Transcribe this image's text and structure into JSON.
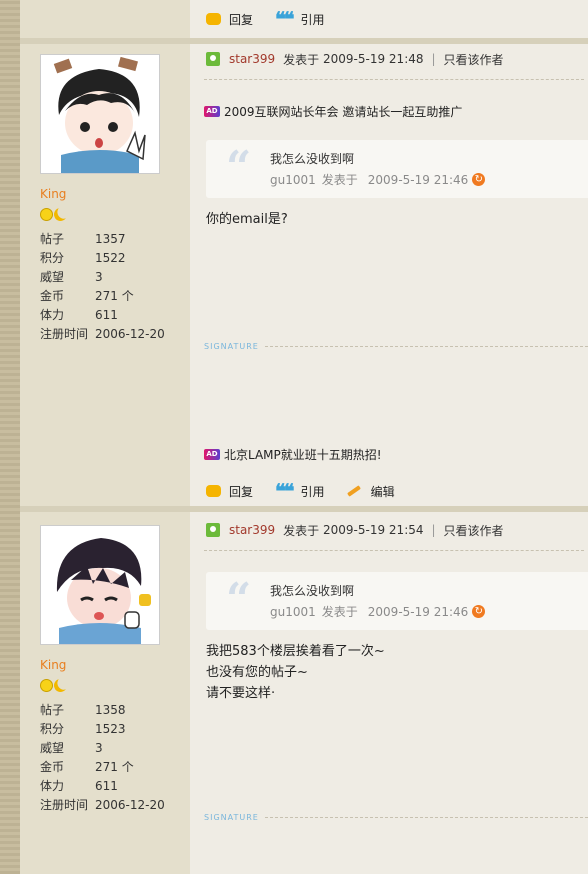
{
  "actions_labels": {
    "reply": "回复",
    "quote": "引用",
    "edit": "编辑"
  },
  "posts": [
    {
      "user": {
        "name": "King",
        "stats": [
          {
            "k": "帖子",
            "v": "1357"
          },
          {
            "k": "积分",
            "v": "1522"
          },
          {
            "k": "威望",
            "v": "3"
          },
          {
            "k": "金币",
            "v": "271 个"
          },
          {
            "k": "体力",
            "v": "611"
          },
          {
            "k": "注册时间",
            "v": "2006-12-20"
          }
        ]
      },
      "header": {
        "author": "star399",
        "posted_label": "发表于",
        "time": "2009-5-19 21:48",
        "only_author": "只看该作者"
      },
      "ad_top": "2009互联网站长年会 邀请站长一起互助推广",
      "quote": {
        "text": "我怎么没收到啊",
        "author": "gu1001",
        "posted_label": "发表于",
        "time": "2009-5-19 21:46"
      },
      "message": [
        "你的email是?"
      ],
      "signature_label": "SIGNATURE",
      "ad_bottom": "北京LAMP就业班十五期热招!"
    },
    {
      "user": {
        "name": "King",
        "stats": [
          {
            "k": "帖子",
            "v": "1358"
          },
          {
            "k": "积分",
            "v": "1523"
          },
          {
            "k": "威望",
            "v": "3"
          },
          {
            "k": "金币",
            "v": "271 个"
          },
          {
            "k": "体力",
            "v": "611"
          },
          {
            "k": "注册时间",
            "v": "2006-12-20"
          }
        ]
      },
      "header": {
        "author": "star399",
        "posted_label": "发表于",
        "time": "2009-5-19 21:54",
        "only_author": "只看该作者"
      },
      "quote": {
        "text": "我怎么没收到啊",
        "author": "gu1001",
        "posted_label": "发表于",
        "time": "2009-5-19 21:46"
      },
      "message": [
        "我把583个楼层挨着看了一次~",
        "也没有您的帖子~",
        "请不要这样·"
      ],
      "signature_label": "SIGNATURE"
    }
  ]
}
